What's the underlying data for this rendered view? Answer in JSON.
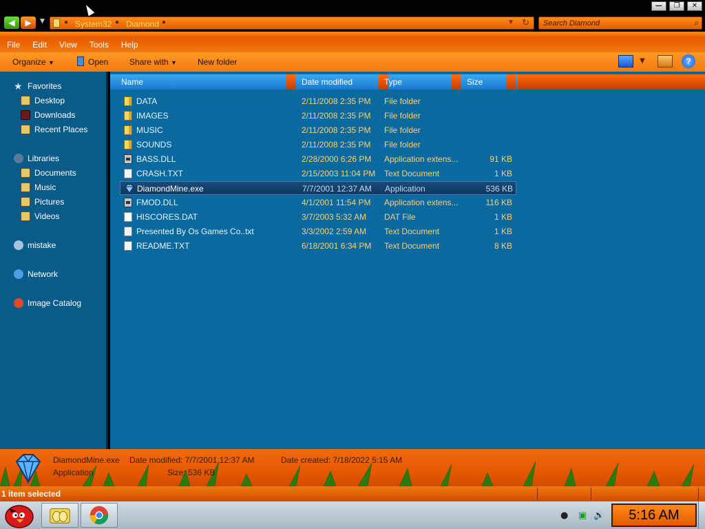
{
  "window": {
    "controls": {
      "minimize": "—",
      "maximize": "❐",
      "close": "✕"
    }
  },
  "address": {
    "crumbs": [
      "System32",
      "Diamond"
    ],
    "search_placeholder": "Search Diamond"
  },
  "menu": [
    "File",
    "Edit",
    "View",
    "Tools",
    "Help"
  ],
  "toolbar": {
    "organize": "Organize",
    "open": "Open",
    "share_with": "Share with",
    "new_folder": "New folder",
    "help": "?"
  },
  "nav": {
    "favorites": "Favorites",
    "desktop": "Desktop",
    "downloads": "Downloads",
    "recent_places": "Recent Places",
    "libraries": "Libraries",
    "documents": "Documents",
    "music": "Music",
    "pictures": "Pictures",
    "videos": "Videos",
    "mistake": "mistake",
    "network": "Network",
    "image_catalog": "Image Catalog"
  },
  "columns": {
    "name": "Name",
    "date": "Date modified",
    "type": "Type",
    "size": "Size"
  },
  "files": [
    {
      "name": "DATA",
      "date": "2/11/2008 2:35 PM",
      "type": "File folder",
      "size": "",
      "icon": "folder-icon"
    },
    {
      "name": "IMAGES",
      "date": "2/11/2008 2:35 PM",
      "type": "File folder",
      "size": "",
      "icon": "folder-icon"
    },
    {
      "name": "MUSIC",
      "date": "2/11/2008 2:35 PM",
      "type": "File folder",
      "size": "",
      "icon": "folder-icon"
    },
    {
      "name": "SOUNDS",
      "date": "2/11/2008 2:35 PM",
      "type": "File folder",
      "size": "",
      "icon": "folder-icon"
    },
    {
      "name": "BASS.DLL",
      "date": "2/28/2000 6:26 PM",
      "type": "Application extens...",
      "size": "91 KB",
      "icon": "dll-icon"
    },
    {
      "name": "CRASH.TXT",
      "date": "2/15/2003 11:04 PM",
      "type": "Text Document",
      "size": "1 KB",
      "icon": "text-file-icon"
    },
    {
      "name": "DiamondMine.exe",
      "date": "7/7/2001 12:37 AM",
      "type": "Application",
      "size": "536 KB",
      "icon": "diamond-icon",
      "selected": true
    },
    {
      "name": "FMOD.DLL",
      "date": "4/1/2001 11:54 PM",
      "type": "Application extens...",
      "size": "116 KB",
      "icon": "dll-icon"
    },
    {
      "name": "HISCORES.DAT",
      "date": "3/7/2003 5:32 AM",
      "type": "DAT File",
      "size": "1 KB",
      "icon": "dat-file-icon"
    },
    {
      "name": "Presented By Os Games Co..txt",
      "date": "3/3/2002 2:59 AM",
      "type": "Text Document",
      "size": "1 KB",
      "icon": "text-file-icon"
    },
    {
      "name": "README.TXT",
      "date": "6/18/2001 6:34 PM",
      "type": "Text Document",
      "size": "8 KB",
      "icon": "text-file-icon"
    }
  ],
  "details": {
    "name": "DiamondMine.exe",
    "type": "Application",
    "modified": "Date modified: 7/7/2001 12:37 AM",
    "size": "Size: 536 KB",
    "created": "Date created: 7/18/2022 5:15 AM"
  },
  "status": {
    "text": "1 item selected"
  },
  "taskbar": {
    "clock": "5:16 AM"
  },
  "colors": {
    "accent_orange": "#f07a10",
    "pane_blue": "#0a6aa0",
    "header_blue": "#3aa8f0",
    "date_text": "#ffcf6a"
  }
}
